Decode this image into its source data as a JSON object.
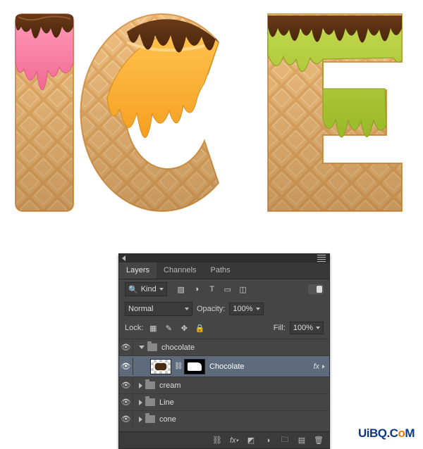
{
  "art": {
    "text": "ICE"
  },
  "panel": {
    "tabs": [
      {
        "label": "Layers",
        "active": true
      },
      {
        "label": "Channels",
        "active": false
      },
      {
        "label": "Paths",
        "active": false
      }
    ],
    "filter": {
      "kind_label": "Kind"
    },
    "blend": {
      "mode": "Normal",
      "opacity_label": "Opacity:",
      "opacity_value": "100%"
    },
    "lock": {
      "label": "Lock:",
      "fill_label": "Fill:",
      "fill_value": "100%"
    },
    "layers": {
      "group0": {
        "name": "chocolate"
      },
      "layer0": {
        "name": "Chocolate",
        "fx": "fx"
      },
      "group1": {
        "name": "cream"
      },
      "group2": {
        "name": "Line"
      },
      "group3": {
        "name": "cone"
      }
    }
  },
  "credit": {
    "a": "UiBQ.C",
    "b": "o",
    "c": "M"
  }
}
